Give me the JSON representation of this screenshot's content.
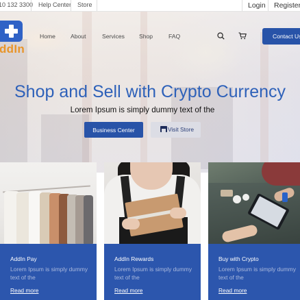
{
  "topbar": {
    "phone": "10 132 3300",
    "help": "Help Center",
    "store": "Store",
    "login": "Login",
    "register": "Register"
  },
  "brand": {
    "logo_text": "ddIn",
    "logo_icon": "plus-icon",
    "accent": "#e8952a",
    "primary": "#2853a8"
  },
  "nav": {
    "items": [
      "Home",
      "About",
      "Services",
      "Shop",
      "FAQ"
    ],
    "search_icon": "search-icon",
    "cart_icon": "cart-icon",
    "contact_label": "Contact Us"
  },
  "hero": {
    "title": "Shop and Sell with Crypto Currency",
    "subtitle": "Lorem Ipsum is simply dummy text of the",
    "primary_button": "Business Center",
    "secondary_button": "Visit Store",
    "secondary_icon": "store-icon"
  },
  "cards": [
    {
      "title": "AddIn Pay",
      "text": "Lorem Ipsum is simply dummy text of the",
      "link": "Read more",
      "image": "clothes-rack"
    },
    {
      "title": "AddIn Rewards",
      "text": "Lorem Ipsum is simply dummy text of the",
      "link": "Read more",
      "image": "woman-holding-box"
    },
    {
      "title": "Buy with Crypto",
      "text": "Lorem Ipsum is simply dummy text of the",
      "link": "Read more",
      "image": "payment-terminal"
    }
  ]
}
